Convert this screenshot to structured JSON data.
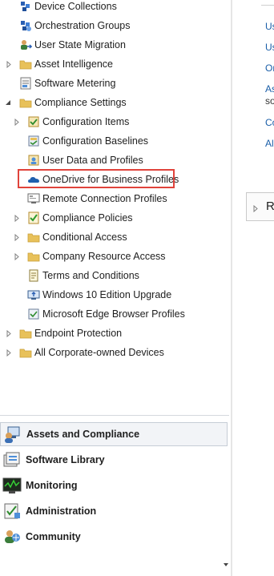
{
  "tree": {
    "items": [
      {
        "label": "Device Collections",
        "icon": "device-collections-icon",
        "expander": "none"
      },
      {
        "label": "Orchestration Groups",
        "icon": "orchestration-groups-icon",
        "expander": "none"
      },
      {
        "label": "User State Migration",
        "icon": "user-state-migration-icon",
        "expander": "none"
      },
      {
        "label": "Asset Intelligence",
        "icon": "folder-icon",
        "expander": "collapsed"
      },
      {
        "label": "Software Metering",
        "icon": "software-metering-icon",
        "expander": "none"
      },
      {
        "label": "Compliance Settings",
        "icon": "folder-icon",
        "expander": "expanded"
      },
      {
        "label": "Configuration Items",
        "icon": "configuration-items-icon",
        "expander": "collapsed"
      },
      {
        "label": "Configuration Baselines",
        "icon": "configuration-baselines-icon",
        "expander": "none"
      },
      {
        "label": "User Data and Profiles",
        "icon": "user-data-profiles-icon",
        "expander": "none"
      },
      {
        "label": "OneDrive for Business Profiles",
        "icon": "onedrive-cloud-icon",
        "expander": "none",
        "highlighted": true
      },
      {
        "label": "Remote Connection Profiles",
        "icon": "remote-connection-icon",
        "expander": "none"
      },
      {
        "label": "Compliance Policies",
        "icon": "compliance-policies-icon",
        "expander": "collapsed"
      },
      {
        "label": "Conditional Access",
        "icon": "folder-icon",
        "expander": "collapsed"
      },
      {
        "label": "Company Resource Access",
        "icon": "folder-icon",
        "expander": "collapsed"
      },
      {
        "label": "Terms and Conditions",
        "icon": "terms-document-icon",
        "expander": "none"
      },
      {
        "label": "Windows 10 Edition Upgrade",
        "icon": "edition-upgrade-icon",
        "expander": "none"
      },
      {
        "label": "Microsoft Edge Browser Profiles",
        "icon": "edge-profile-icon",
        "expander": "none"
      },
      {
        "label": "Endpoint Protection",
        "icon": "folder-icon",
        "expander": "collapsed"
      },
      {
        "label": "All Corporate-owned Devices",
        "icon": "folder-icon",
        "expander": "collapsed"
      }
    ]
  },
  "wunderbar": {
    "items": [
      {
        "label": "Assets and Compliance",
        "icon": "assets-compliance-icon",
        "selected": true
      },
      {
        "label": "Software Library",
        "icon": "software-library-icon",
        "selected": false
      },
      {
        "label": "Monitoring",
        "icon": "monitoring-icon",
        "selected": false
      },
      {
        "label": "Administration",
        "icon": "administration-icon",
        "selected": false
      },
      {
        "label": "Community",
        "icon": "community-icon",
        "selected": false
      }
    ]
  },
  "right_pane": {
    "links": [
      "Us",
      "Us",
      "Or",
      "As",
      "Co",
      "Al"
    ],
    "subtext": "so",
    "ribbon_label": "R"
  },
  "colors": {
    "highlight_border": "#e0433b",
    "link": "#1a5ea8",
    "folder": "#e8c15a",
    "selected_bg": "#f2f4f7"
  }
}
